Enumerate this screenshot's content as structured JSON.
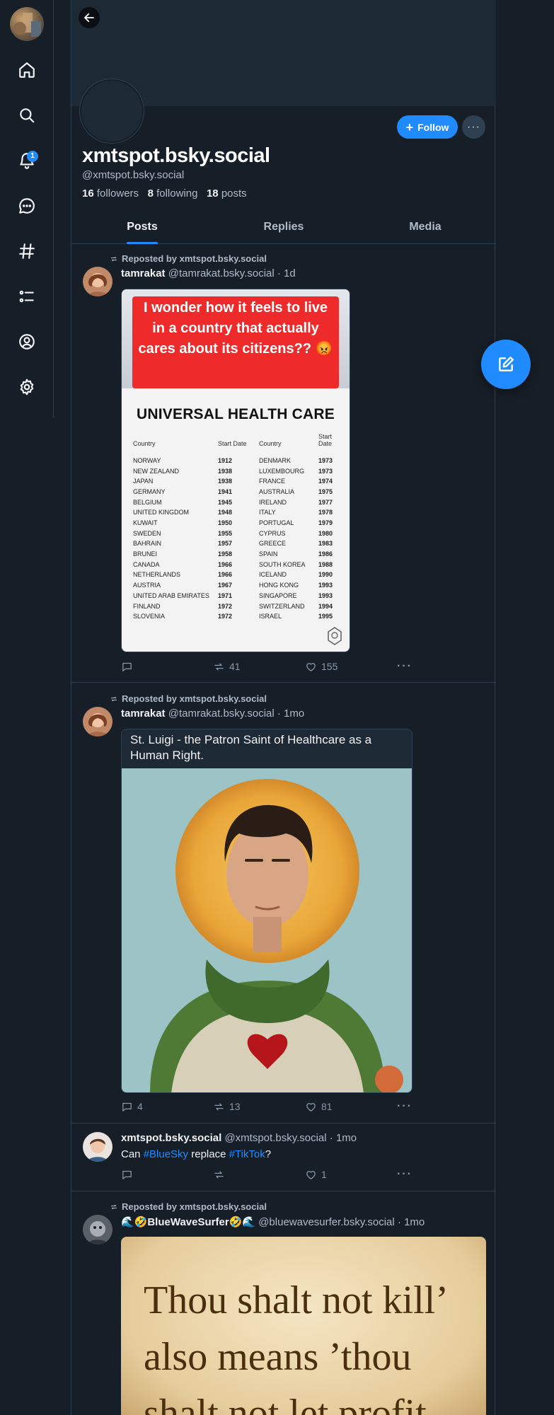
{
  "nav": {
    "notification_count": "1",
    "items": [
      "home-icon",
      "search-icon",
      "bell-icon",
      "chat-icon",
      "hashtag-icon",
      "list-icon",
      "profile-icon",
      "gear-icon"
    ]
  },
  "profile": {
    "display_name": "xmtspot.bsky.social",
    "handle": "@xmtspot.bsky.social",
    "followers_count": "16",
    "followers_label": "followers",
    "following_count": "8",
    "following_label": "following",
    "posts_count": "18",
    "posts_label": "posts",
    "follow_label": "Follow",
    "more_label": "···"
  },
  "tabs": [
    {
      "label": "Posts",
      "active": true
    },
    {
      "label": "Replies",
      "active": false
    },
    {
      "label": "Media",
      "active": false
    }
  ],
  "posts": [
    {
      "repost_label": "Reposted by xmtspot.bsky.social",
      "author_name": "tamrakat",
      "author_meta": "@tamrakat.bsky.social · 1d",
      "replies": "",
      "reposts": "41",
      "likes": "155",
      "meme": {
        "headline": "I wonder how it feels to live in a country that actually cares about its citizens?? 😡",
        "title": "UNIVERSAL HEALTH CARE",
        "headers": [
          "Country",
          "Start Date",
          "Country",
          "Start Date"
        ],
        "rows": [
          [
            "NORWAY",
            "1912",
            "DENMARK",
            "1973"
          ],
          [
            "NEW ZEALAND",
            "1938",
            "LUXEMBOURG",
            "1973"
          ],
          [
            "JAPAN",
            "1938",
            "FRANCE",
            "1974"
          ],
          [
            "GERMANY",
            "1941",
            "AUSTRALIA",
            "1975"
          ],
          [
            "BELGIUM",
            "1945",
            "IRELAND",
            "1977"
          ],
          [
            "UNITED KINGDOM",
            "1948",
            "ITALY",
            "1978"
          ],
          [
            "KUWAIT",
            "1950",
            "PORTUGAL",
            "1979"
          ],
          [
            "SWEDEN",
            "1955",
            "CYPRUS",
            "1980"
          ],
          [
            "BAHRAIN",
            "1957",
            "GREECE",
            "1983"
          ],
          [
            "BRUNEI",
            "1958",
            "SPAIN",
            "1986"
          ],
          [
            "CANADA",
            "1966",
            "SOUTH KOREA",
            "1988"
          ],
          [
            "NETHERLANDS",
            "1966",
            "ICELAND",
            "1990"
          ],
          [
            "AUSTRIA",
            "1967",
            "HONG KONG",
            "1993"
          ],
          [
            "UNITED ARAB EMIRATES",
            "1971",
            "SINGAPORE",
            "1993"
          ],
          [
            "FINLAND",
            "1972",
            "SWITZERLAND",
            "1994"
          ],
          [
            "SLOVENIA",
            "1972",
            "ISRAEL",
            "1995"
          ]
        ]
      }
    },
    {
      "repost_label": "Reposted by xmtspot.bsky.social",
      "author_name": "tamrakat",
      "author_meta": "@tamrakat.bsky.social · 1mo",
      "card_title": "St. Luigi - the Patron Saint of Healthcare as a Human Right.",
      "replies": "4",
      "reposts": "13",
      "likes": "81"
    },
    {
      "author_name": "xmtspot.bsky.social",
      "author_meta": "@xmtspot.bsky.social · 1mo",
      "text_before": "Can ",
      "tag1": "#BlueSky",
      "text_mid": " replace ",
      "tag2": "#TikTok",
      "text_after": "?",
      "replies": "",
      "reposts": "",
      "likes": "1"
    },
    {
      "repost_label": "Reposted by xmtspot.bsky.social",
      "author_name": "🌊🤣BlueWaveSurfer🤣🌊",
      "author_meta": "@bluewavesurfer.bsky.social · 1mo",
      "quote_lines": [
        "Thou shalt not kill’",
        "also means ’thou",
        "shalt not let profit"
      ]
    }
  ],
  "colors": {
    "background": "#161e27",
    "accent": "#208bfe",
    "border": "#2e4052",
    "muted_text": "#aebbc9"
  }
}
